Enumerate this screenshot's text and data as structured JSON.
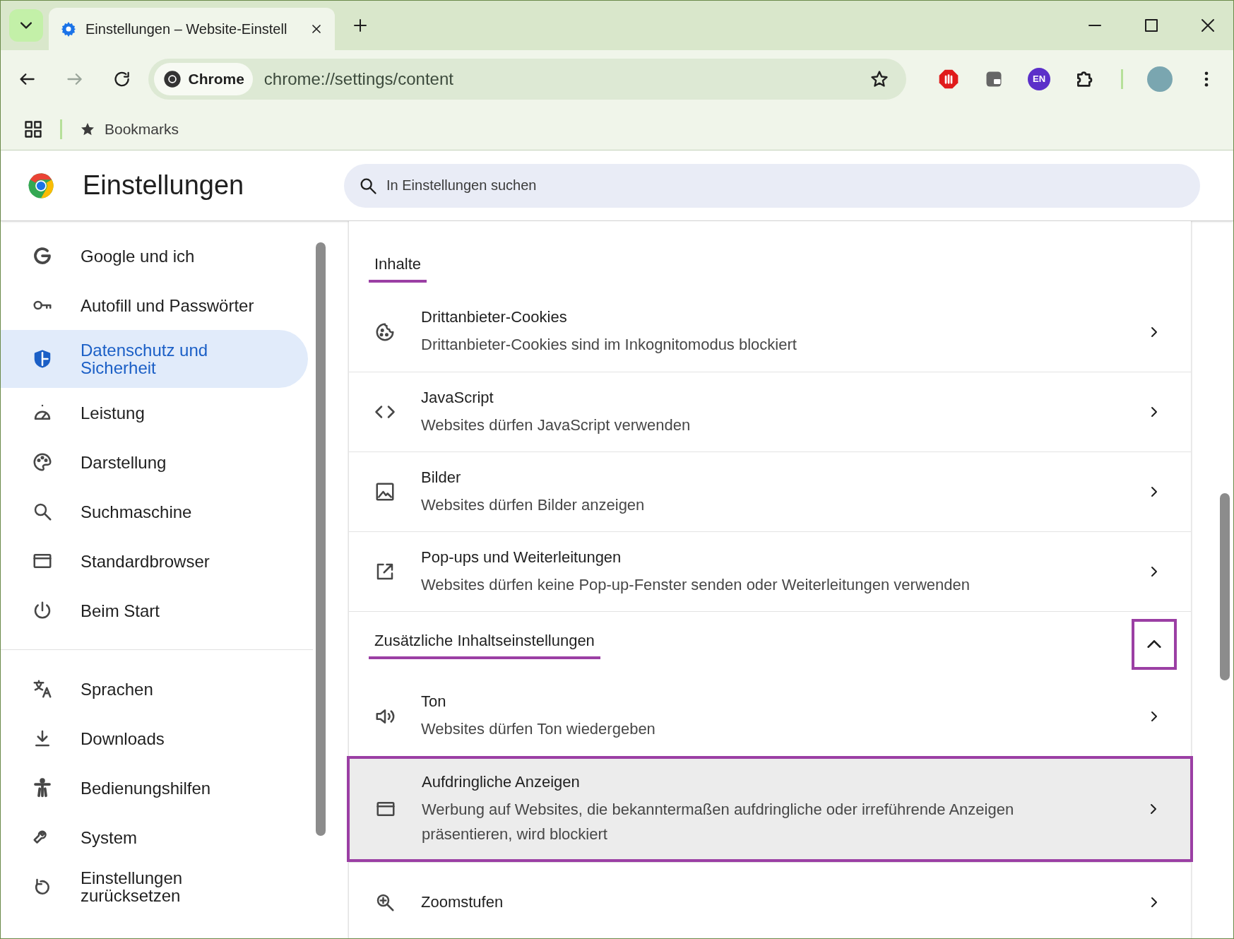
{
  "tab_strip": {
    "tabs": [
      {
        "title": "Einstellungen – Website-Einstell",
        "selected": true
      }
    ]
  },
  "toolbar": {
    "chip": "Chrome",
    "url": "chrome://settings/content",
    "extension_badge": "EN"
  },
  "bookmarks_bar": {
    "items": [
      "Bookmarks"
    ]
  },
  "header": {
    "title": "Einstellungen",
    "search": {
      "placeholder": "In Einstellungen suchen"
    }
  },
  "sidebar": {
    "groups": [
      [
        {
          "kind": "google",
          "label": "Google und ich",
          "selected": false
        },
        {
          "kind": "key",
          "label": "Autofill und Passwörter",
          "selected": false
        },
        {
          "kind": "shield",
          "label": "Datenschutz und Sicherheit",
          "selected": true
        },
        {
          "kind": "gauge",
          "label": "Leistung",
          "selected": false
        },
        {
          "kind": "palette",
          "label": "Darstellung",
          "selected": false
        },
        {
          "kind": "search",
          "label": "Suchmaschine",
          "selected": false
        },
        {
          "kind": "window",
          "label": "Standardbrowser",
          "selected": false
        },
        {
          "kind": "power",
          "label": "Beim Start",
          "selected": false
        }
      ],
      [
        {
          "kind": "translate",
          "label": "Sprachen",
          "selected": false
        },
        {
          "kind": "download",
          "label": "Downloads",
          "selected": false
        },
        {
          "kind": "person",
          "label": "Bedienungshilfen",
          "selected": false
        },
        {
          "kind": "wrench",
          "label": "System",
          "selected": false
        },
        {
          "kind": "reset",
          "label": "Einstellungen zurücksetzen",
          "selected": false
        }
      ]
    ]
  },
  "content": {
    "sections": [
      {
        "title": "Inhalte",
        "underlined": true,
        "rows": [
          {
            "kind": "cookie",
            "title": "Drittanbieter-Cookies",
            "subtitle": "Drittanbieter-Cookies sind im Inkognitomodus blockiert",
            "highlighted": false
          },
          {
            "kind": "code",
            "title": "JavaScript",
            "subtitle": "Websites dürfen JavaScript verwenden",
            "highlighted": false
          },
          {
            "kind": "image",
            "title": "Bilder",
            "subtitle": "Websites dürfen Bilder anzeigen",
            "highlighted": false
          },
          {
            "kind": "popup",
            "title": "Pop-ups und Weiterleitungen",
            "subtitle": "Websites dürfen keine Pop-up-Fenster senden oder Weiterleitungen verwenden",
            "highlighted": false
          }
        ]
      },
      {
        "title": "Zusätzliche Inhaltseinstellungen",
        "underlined": true,
        "expanded": true,
        "toggle_highlighted": true,
        "rows": [
          {
            "kind": "sound",
            "title": "Ton",
            "subtitle": "Websites dürfen Ton wiedergeben",
            "highlighted": false
          },
          {
            "kind": "window",
            "title": "Aufdringliche Anzeigen",
            "subtitle": "Werbung auf Websites, die bekanntermaßen aufdringliche oder irreführende Anzeigen präsentieren, wird blockiert",
            "highlighted": true
          },
          {
            "kind": "zoom",
            "title": "Zoomstufen",
            "highlighted": false
          }
        ]
      }
    ]
  }
}
